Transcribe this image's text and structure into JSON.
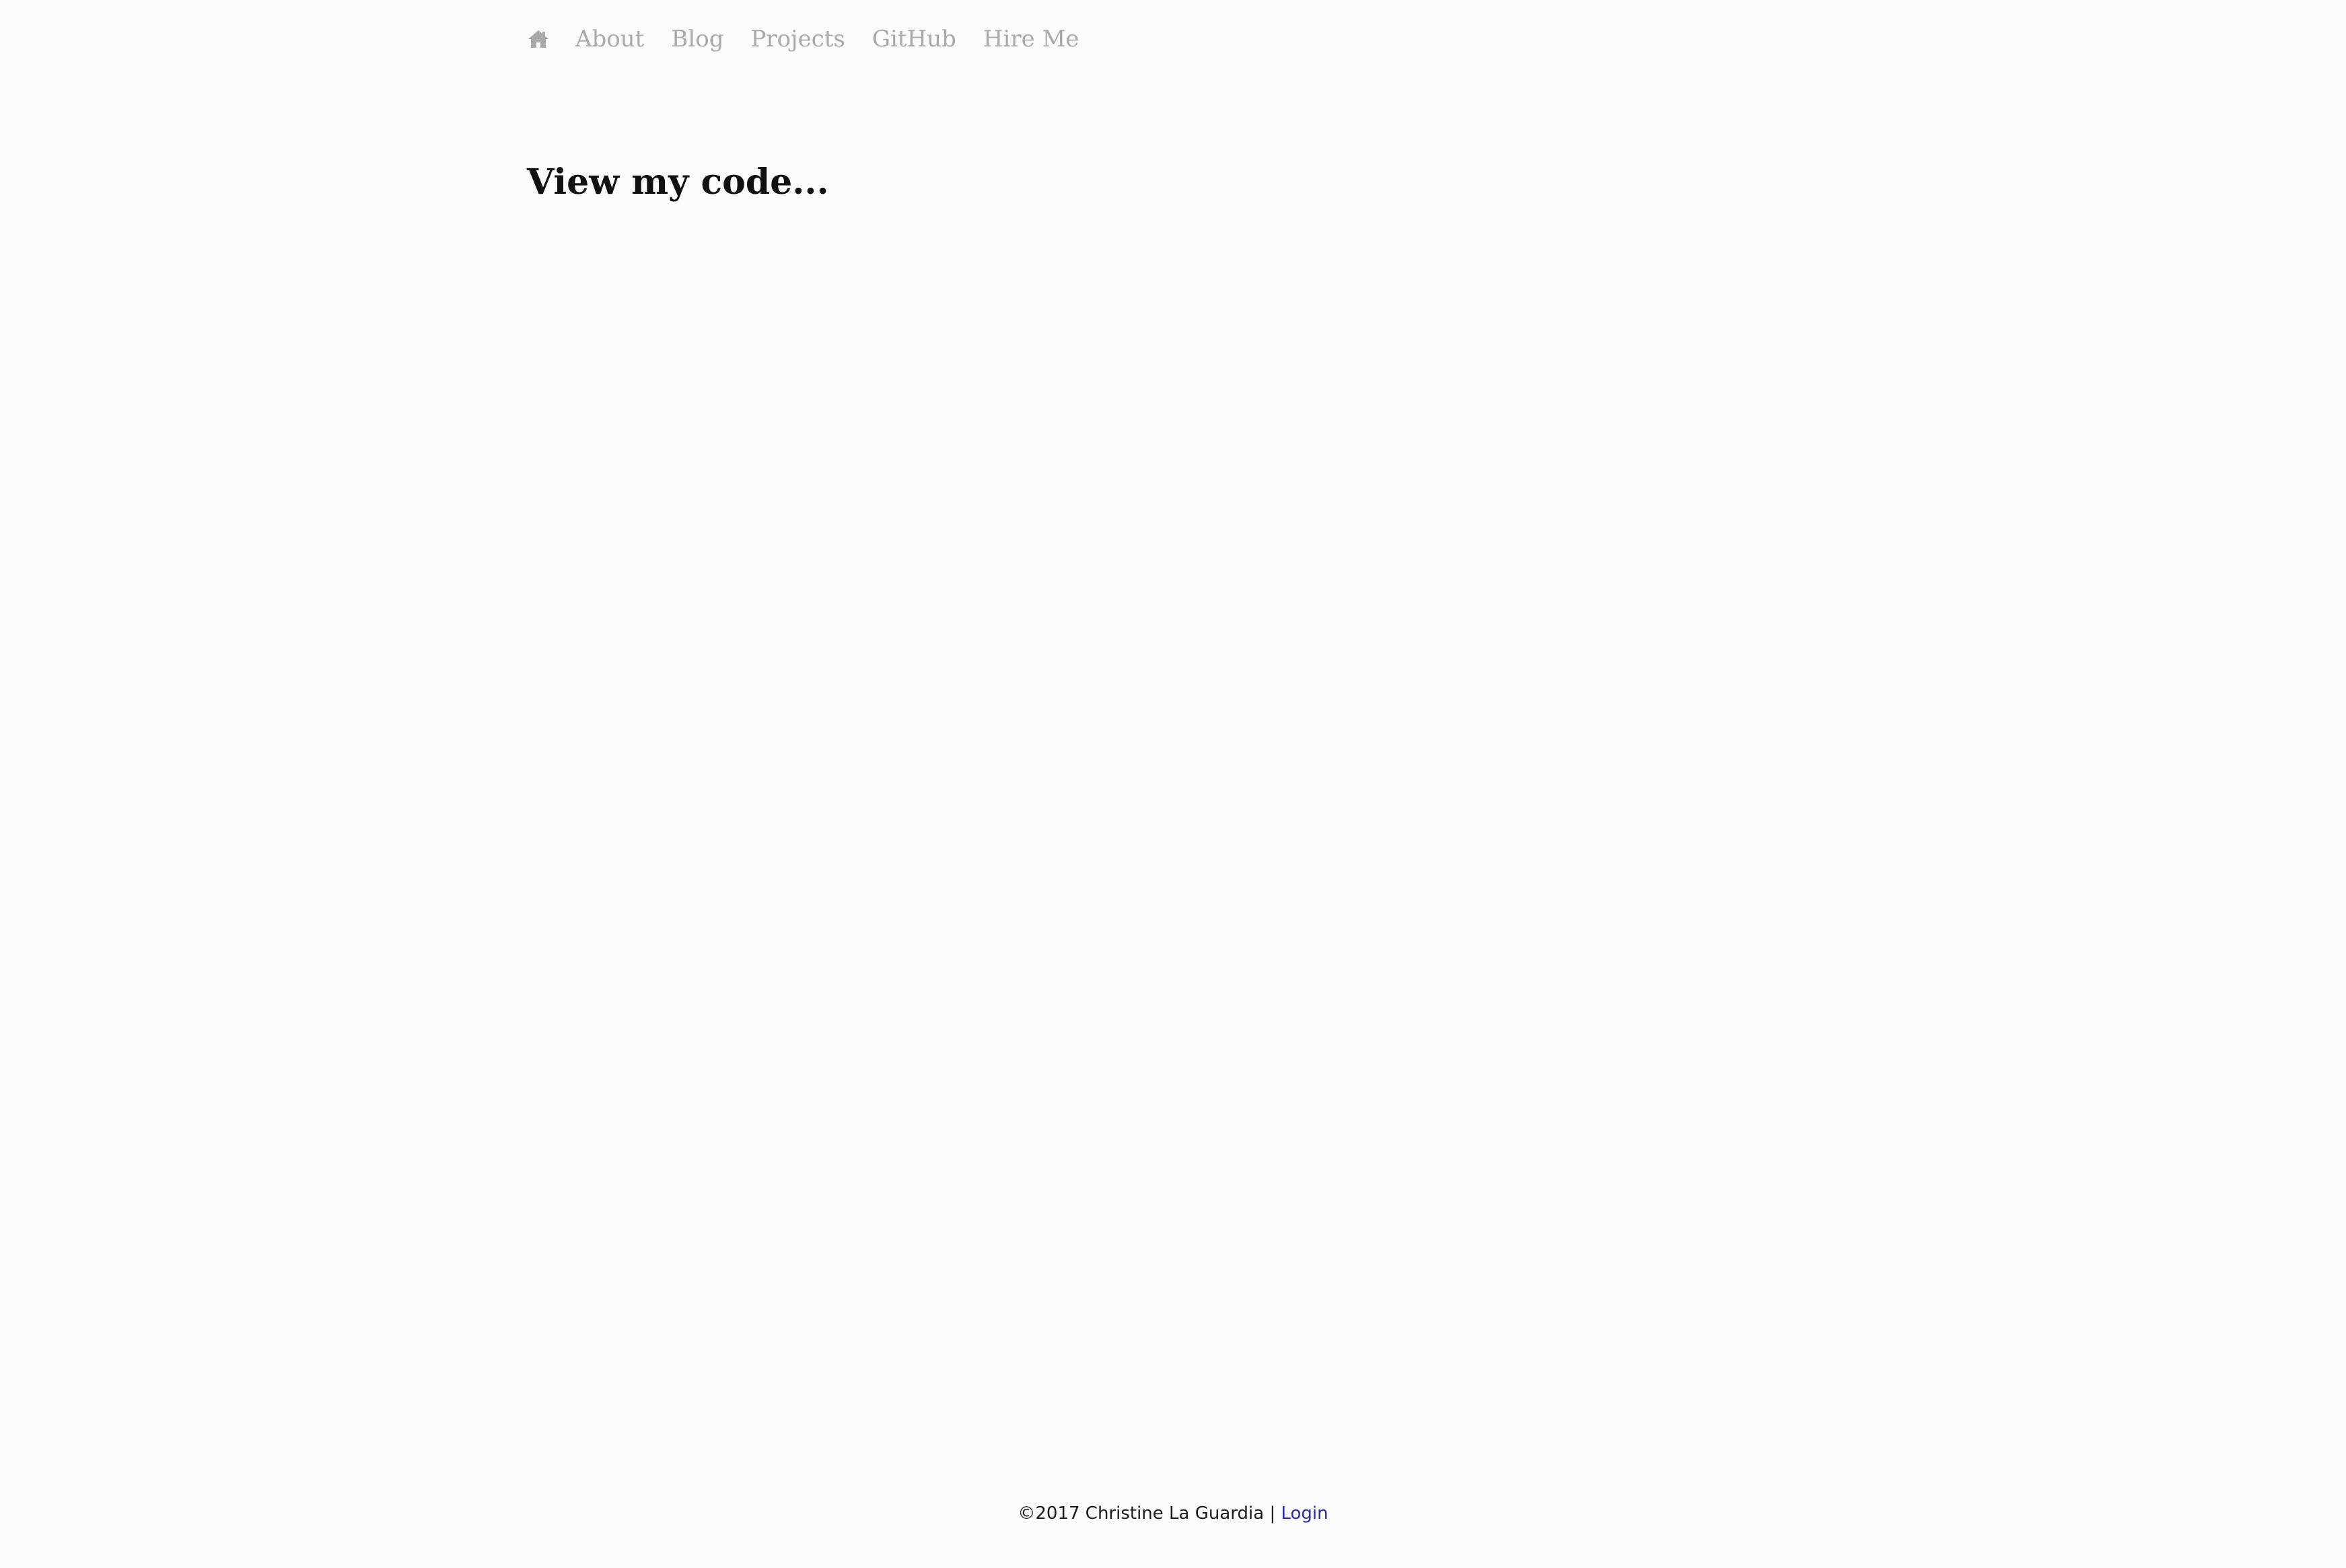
{
  "nav": {
    "home_icon": "home-icon",
    "items": [
      {
        "label": "About"
      },
      {
        "label": "Blog"
      },
      {
        "label": "Projects"
      },
      {
        "label": "GitHub"
      },
      {
        "label": "Hire Me"
      }
    ],
    "link_color": "#a9a9a9"
  },
  "main": {
    "title": "View my code..."
  },
  "footer": {
    "copyright": "©2017 Christine La Guardia",
    "separator": "|",
    "login_label": "Login",
    "login_color": "#2a2ab0"
  },
  "colors": {
    "background": "#fafafa",
    "text": "#111111"
  }
}
